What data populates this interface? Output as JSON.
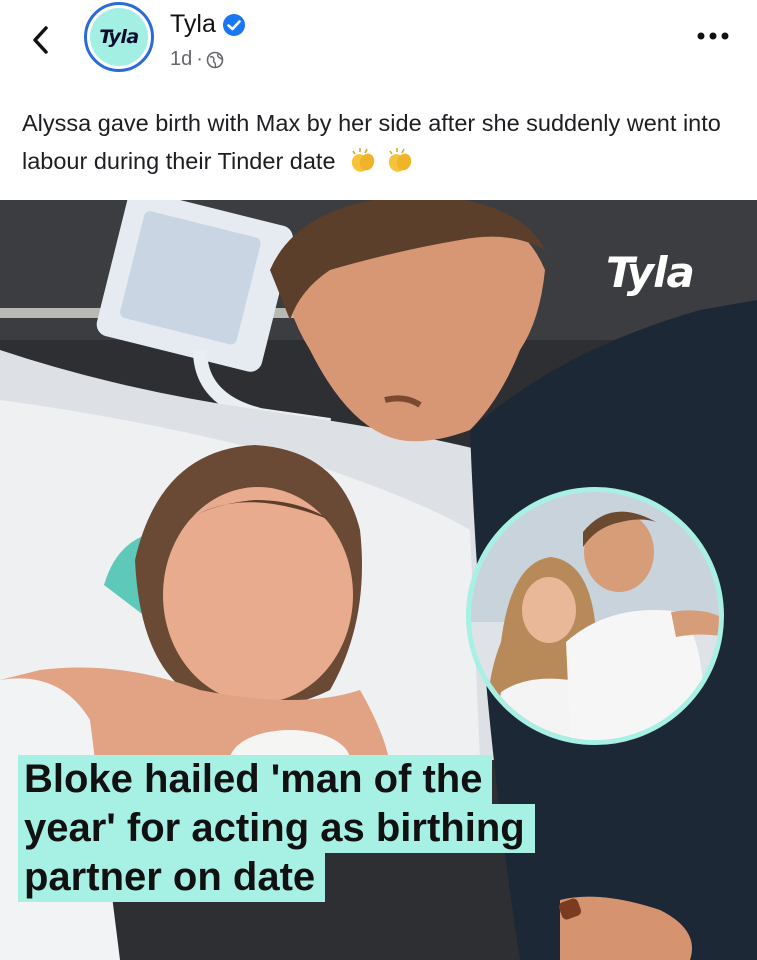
{
  "post": {
    "author": "Tyla",
    "avatar_text": "Tyla",
    "time": "1d",
    "dot": "·",
    "caption": "Alyssa gave birth with Max by her side after she suddenly went into labour during their Tinder date",
    "caption_emoji": "clapping-hands-icon"
  },
  "image": {
    "watermark": "Tyla",
    "headline_lines": [
      "Bloke hailed 'man of the",
      "year' for acting as birthing",
      "partner on date"
    ],
    "accent_color": "#a7f0e4"
  },
  "colors": {
    "verified": "#1877f2",
    "text_secondary": "#65676b"
  }
}
